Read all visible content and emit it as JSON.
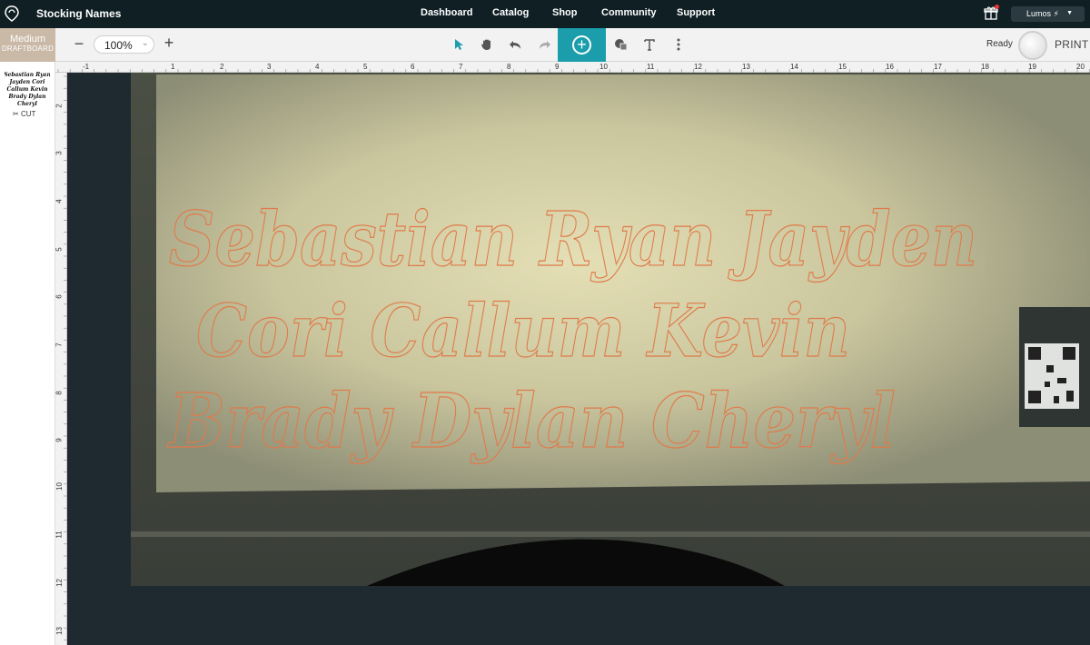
{
  "app": {
    "project_title": "Stocking Names"
  },
  "nav": {
    "items": [
      "Dashboard",
      "Catalog",
      "Shop",
      "Community",
      "Support"
    ]
  },
  "account": {
    "device_name": "Lumos ⚡"
  },
  "board": {
    "line1": "Medium",
    "line2": "DRAFTBOARD"
  },
  "toolbar": {
    "zoom_minus": "−",
    "zoom_value": "100%",
    "zoom_plus": "+",
    "add": "+",
    "status": "Ready",
    "print_label": "PRINT"
  },
  "layers": {
    "thumb_text": "Sebastian Ryan Jayden Cori Callum Kevin Brady Dylan Cheryl",
    "cut_label": "CUT"
  },
  "rulers": {
    "top": [
      "-1",
      "1",
      "2",
      "3",
      "4",
      "5",
      "6",
      "7",
      "8",
      "9",
      "10",
      "11",
      "12",
      "13",
      "14",
      "15",
      "16",
      "17",
      "18",
      "19",
      "20"
    ],
    "left": [
      "2",
      "3",
      "4",
      "5",
      "6",
      "7",
      "8",
      "9",
      "10",
      "11",
      "12",
      "13"
    ]
  },
  "design": {
    "lines": [
      "Sebastian Ryan Jayden",
      "Cori Callum Kevin",
      "Brady Dylan Cheryl"
    ],
    "stroke_color": "#e07a4a"
  },
  "colors": {
    "accent": "#1b9dab",
    "topbar": "#0f1f24",
    "board_tab": "#c9b9a6"
  }
}
